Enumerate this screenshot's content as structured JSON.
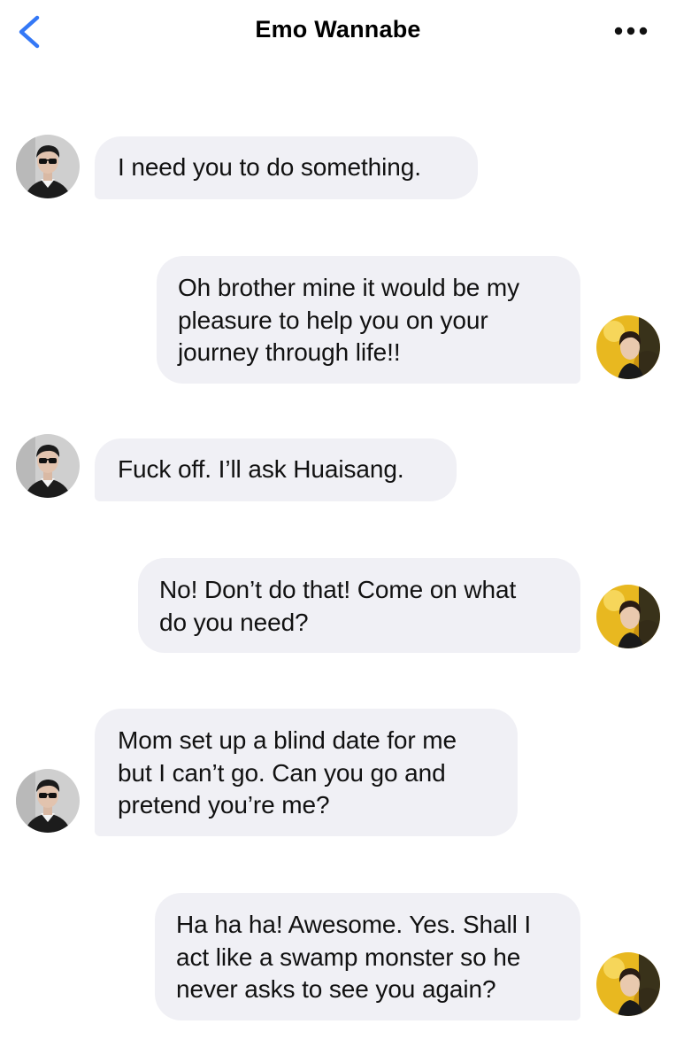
{
  "header": {
    "title": "Emo Wannabe",
    "back_icon": "chevron-left-icon",
    "more_icon": "more-horizontal-icon",
    "accent_color": "#3478f6"
  },
  "messages": [
    {
      "sender": "contact",
      "text": "I need you to do something."
    },
    {
      "sender": "me",
      "text": "Oh brother mine it would be my\npleasure to help you on your\njourney through life!!"
    },
    {
      "sender": "contact",
      "text": "Fuck off. I’ll ask Huaisang."
    },
    {
      "sender": "me",
      "text": "No! Don’t do that! Come on what\ndo you need?"
    },
    {
      "sender": "contact",
      "text": "Mom set up a blind date for me\nbut I can’t go. Can you go and\npretend you’re me?"
    },
    {
      "sender": "me",
      "text": "Ha ha ha! Awesome. Yes. Shall I\nact like a swamp monster so he\nnever asks to see you again?"
    }
  ],
  "colors": {
    "bubble_background": "#f0f0f5",
    "text": "#111111",
    "my_avatar_tone": "#e8b820",
    "contact_avatar_tone": "#c8c8c8"
  }
}
